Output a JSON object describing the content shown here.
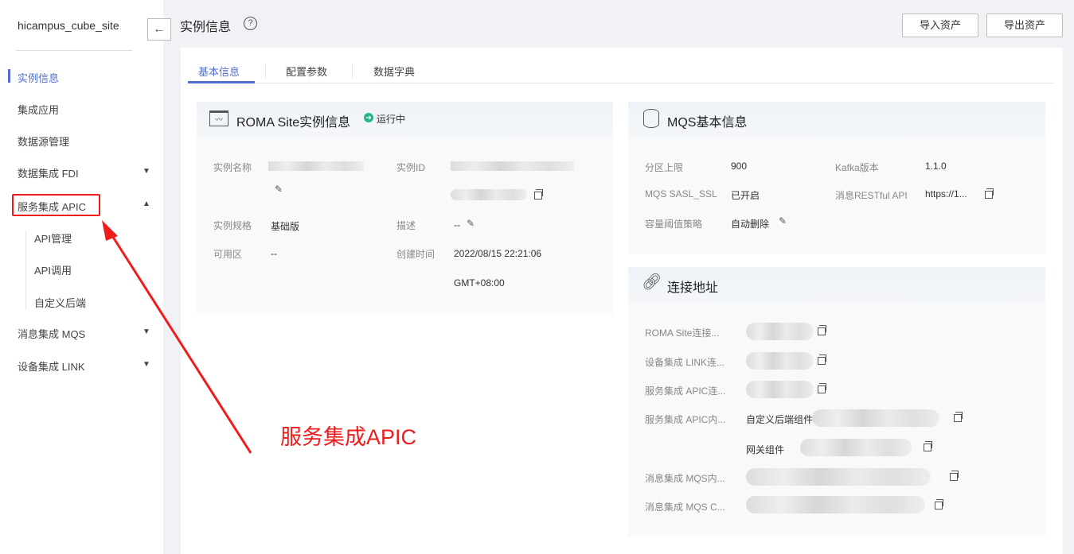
{
  "sidebar": {
    "site": "hicampus_cube_site",
    "items": [
      {
        "label": "实例信息"
      },
      {
        "label": "集成应用"
      },
      {
        "label": "数据源管理"
      },
      {
        "label": "数据集成 FDI"
      },
      {
        "label": "服务集成 APIC"
      },
      {
        "label": "API管理"
      },
      {
        "label": "API调用"
      },
      {
        "label": "自定义后端"
      },
      {
        "label": "消息集成 MQS"
      },
      {
        "label": "设备集成 LINK"
      }
    ]
  },
  "header": {
    "title": "实例信息",
    "import": "导入资产",
    "export": "导出资产"
  },
  "tabs": [
    "基本信息",
    "配置参数",
    "数据字典"
  ],
  "roma": {
    "title": "ROMA Site实例信息",
    "status": "运行中",
    "name_label": "实例名称",
    "id_label": "实例ID",
    "spec_label": "实例规格",
    "spec": "基础版",
    "desc_label": "描述",
    "desc": "--",
    "az_label": "可用区",
    "az": "--",
    "created_label": "创建时间",
    "created": "2022/08/15 22:21:06",
    "tz": "GMT+08:00"
  },
  "mqs": {
    "title": "MQS基本信息",
    "partition_label": "分区上限",
    "partition": "900",
    "kafka_label": "Kafka版本",
    "kafka": "1.1.0",
    "sasl_label": "MQS SASL_SSL",
    "sasl": "已开启",
    "rest_label": "消息RESTful API",
    "rest": "https://1...",
    "policy_label": "容量阈值策略",
    "policy": "自动删除"
  },
  "conn": {
    "title": "连接地址",
    "rows": [
      "ROMA Site连接...",
      "设备集成 LINK连...",
      "服务集成 APIC连...",
      "服务集成 APIC内...",
      "消息集成 MQS内...",
      "消息集成 MQS C..."
    ],
    "custom": "自定义后端组件",
    "gateway": "网关组件"
  },
  "annotation": {
    "text": "服务集成APIC",
    "color": "#ee1c1c"
  }
}
